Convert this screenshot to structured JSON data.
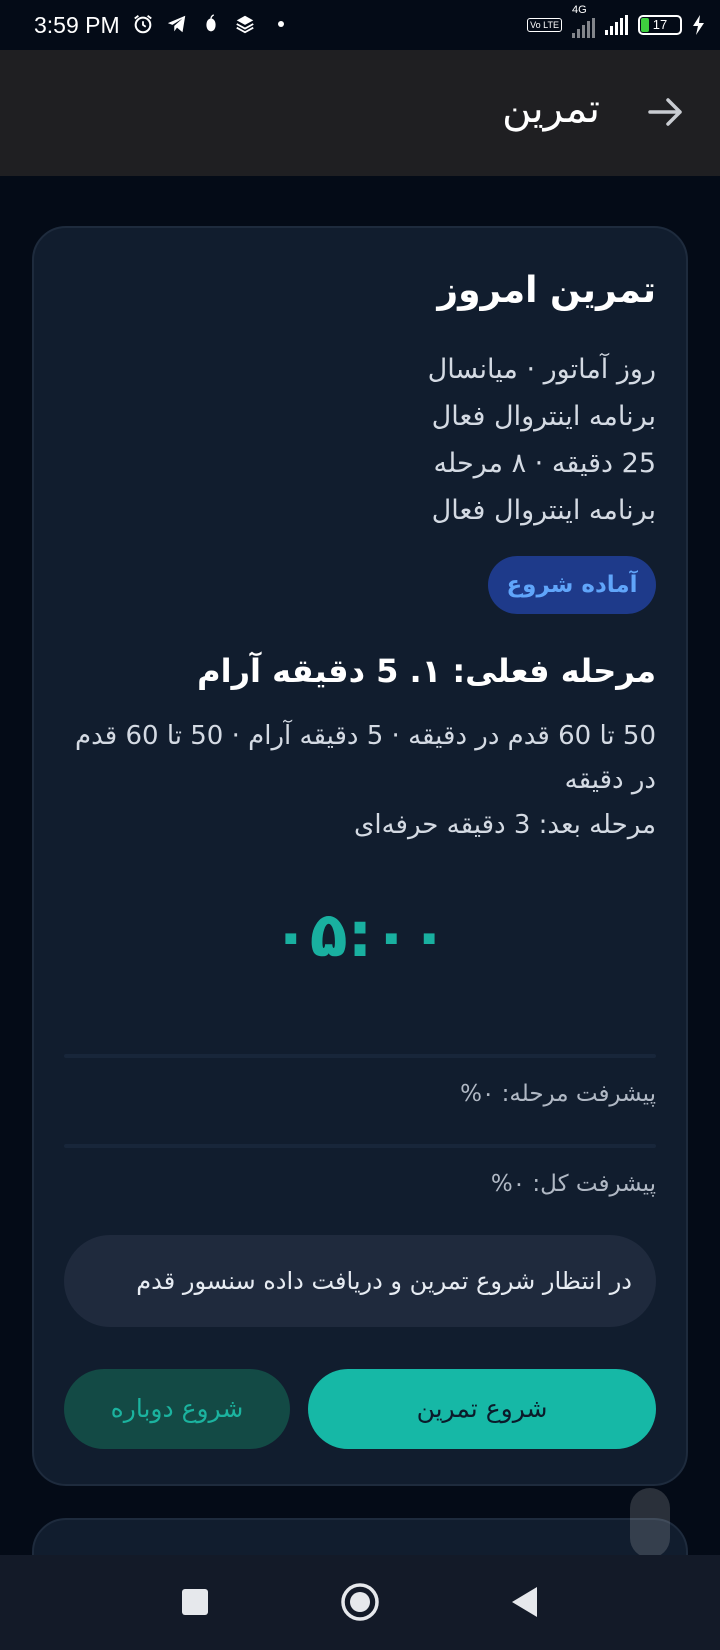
{
  "status_bar": {
    "time": "3:59 PM",
    "network_label": "4G",
    "volte_label": "Vo LTE",
    "battery_level": "17",
    "icons": [
      "alarm-icon",
      "telegram-icon",
      "app-icon",
      "layers-icon",
      "dot-icon",
      "signal-icon",
      "battery-icon",
      "charging-icon"
    ]
  },
  "app_bar": {
    "title": "تمرین",
    "back_icon": "arrow-right-icon"
  },
  "workout": {
    "title": "تمرین امروز",
    "info_lines": [
      "روز آماتور · میانسال",
      "برنامه اینتروال فعال",
      "25 دقیقه · ۸ مرحله",
      "برنامه اینتروال فعال"
    ],
    "status_label": "آماده شروع",
    "current_stage": "مرحله فعلی: ۱. 5 دقیقه آرام",
    "stage_description": "50 تا 60 قدم در دقیقه · 5 دقیقه آرام · 50 تا 60 قدم در دقیقه",
    "next_stage": "مرحله بعد: 3 دقیقه حرفه‌ای",
    "timer": "۰۵:۰۰",
    "stage_progress_label": "پیشرفت مرحله: ۰%",
    "stage_progress": 0,
    "total_progress_label": "پیشرفت کل: ۰%",
    "total_progress": 0,
    "message": "در انتظار شروع تمرین و دریافت داده سنسور قدم",
    "start_button": "شروع تمرین",
    "restart_button": "شروع دوباره"
  },
  "colors": {
    "background": "#040b17",
    "card": "#111d2e",
    "accent": "#16b8a6",
    "pill": "#1e3a8a",
    "pill_text": "#60a5fa"
  },
  "navigation_bar": {
    "icons": [
      "recent-apps-icon",
      "home-icon",
      "back-triangle-icon"
    ]
  }
}
